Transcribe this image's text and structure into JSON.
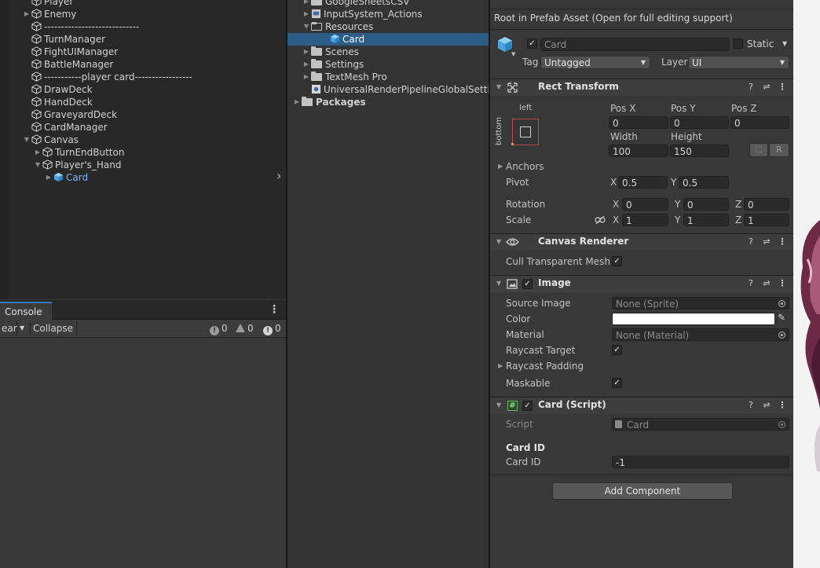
{
  "hierarchy": {
    "items": [
      {
        "label": "Player",
        "depth": 1,
        "arrow": "",
        "selected": false
      },
      {
        "label": "Enemy",
        "depth": 1,
        "arrow": "▶",
        "selected": false
      },
      {
        "label": "----------------------------",
        "depth": 1,
        "arrow": "",
        "selected": false
      },
      {
        "label": "TurnManager",
        "depth": 1,
        "arrow": "",
        "selected": false
      },
      {
        "label": "FightUIManager",
        "depth": 1,
        "arrow": "",
        "selected": false
      },
      {
        "label": "BattleManager",
        "depth": 1,
        "arrow": "",
        "selected": false
      },
      {
        "label": "-----------player card-----------------",
        "depth": 1,
        "arrow": "",
        "selected": false
      },
      {
        "label": "DrawDeck",
        "depth": 1,
        "arrow": "",
        "selected": false
      },
      {
        "label": "HandDeck",
        "depth": 1,
        "arrow": "",
        "selected": false
      },
      {
        "label": "GraveyardDeck",
        "depth": 1,
        "arrow": "",
        "selected": false
      },
      {
        "label": "CardManager",
        "depth": 1,
        "arrow": "",
        "selected": false
      },
      {
        "label": "Canvas",
        "depth": 1,
        "arrow": "▼",
        "selected": false
      },
      {
        "label": "TurnEndButton",
        "depth": 2,
        "arrow": "▶",
        "selected": false
      },
      {
        "label": "Player's_Hand",
        "depth": 2,
        "arrow": "▼",
        "selected": false
      },
      {
        "label": "Card",
        "depth": 3,
        "arrow": "▶",
        "selected": true
      }
    ],
    "expand_chevron": "›"
  },
  "console": {
    "tab_label": "Console",
    "clear_label": "ear",
    "collapse_label": "Collapse",
    "log_count": "0",
    "warning_count": "0",
    "error_count": "0"
  },
  "project": {
    "items": [
      {
        "label": "GoogleSheetsCSV",
        "depth": 1,
        "arrow": "▶",
        "icon": "folder",
        "selected": false
      },
      {
        "label": "InputSystem_Actions",
        "depth": 1,
        "arrow": "▶",
        "icon": "input-actions",
        "selected": false
      },
      {
        "label": "Resources",
        "depth": 1,
        "arrow": "▼",
        "icon": "folder-open",
        "selected": false
      },
      {
        "label": "Card",
        "depth": 2,
        "arrow": "",
        "icon": "prefab",
        "selected": true
      },
      {
        "label": "Scenes",
        "depth": 1,
        "arrow": "▶",
        "icon": "folder",
        "selected": false
      },
      {
        "label": "Settings",
        "depth": 1,
        "arrow": "▶",
        "icon": "folder",
        "selected": false
      },
      {
        "label": "TextMesh Pro",
        "depth": 1,
        "arrow": "▶",
        "icon": "folder",
        "selected": false
      },
      {
        "label": "UniversalRenderPipelineGlobalSettings",
        "depth": 1,
        "arrow": "",
        "icon": "settings-asset",
        "selected": false
      },
      {
        "label": "Packages",
        "depth": 0,
        "arrow": "▶",
        "icon": "folder",
        "selected": false,
        "bold": true
      }
    ]
  },
  "inspector": {
    "notice": "Root in Prefab Asset (Open for full editing support)",
    "object_name": "Card",
    "static_label": "Static",
    "tag_label": "Tag",
    "tag_value": "Untagged",
    "layer_label": "Layer",
    "layer_value": "UI",
    "rect_transform": {
      "title": "Rect Transform",
      "anchor_h": "left",
      "anchor_v": "bottom",
      "pos_x_label": "Pos X",
      "pos_x": "0",
      "pos_y_label": "Pos Y",
      "pos_y": "0",
      "pos_z_label": "Pos Z",
      "pos_z": "0",
      "width_label": "Width",
      "width": "100",
      "height_label": "Height",
      "height": "150",
      "r_button": "R",
      "anchors_label": "Anchors",
      "pivot_label": "Pivot",
      "pivot_x": "0.5",
      "pivot_y": "0.5",
      "rotation_label": "Rotation",
      "rot_x": "0",
      "rot_y": "0",
      "rot_z": "0",
      "scale_label": "Scale",
      "scale_x": "1",
      "scale_y": "1",
      "scale_z": "1",
      "x": "X",
      "y": "Y",
      "z": "Z"
    },
    "canvas_renderer": {
      "title": "Canvas Renderer",
      "cull_label": "Cull Transparent Mesh"
    },
    "image": {
      "title": "Image",
      "source_image_label": "Source Image",
      "source_image": "None (Sprite)",
      "color_label": "Color",
      "color_value": "#ffffff",
      "material_label": "Material",
      "material": "None (Material)",
      "raycast_target_label": "Raycast Target",
      "raycast_padding_label": "Raycast Padding",
      "maskable_label": "Maskable"
    },
    "card_script": {
      "title": "Card (Script)",
      "script_label": "Script",
      "script_value": "Card",
      "section_header": "Card ID",
      "card_id_label": "Card ID",
      "card_id": "-1"
    },
    "add_component": "Add Component"
  },
  "colors": {
    "accent_selection": "#2c5d87",
    "selected_text": "#78b4ff",
    "prefab_blue": "#5bb5f0"
  }
}
